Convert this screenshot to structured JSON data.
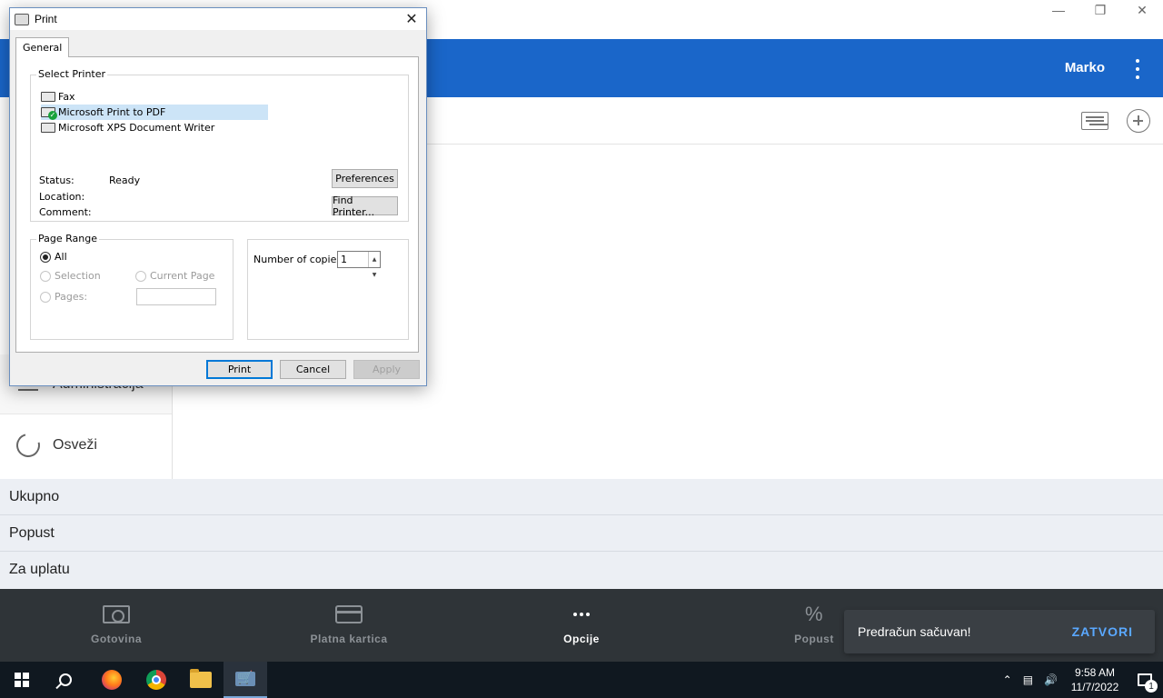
{
  "app": {
    "user_name": "Marko",
    "sidebar": {
      "admin_label": "Administracija",
      "refresh_label": "Osveži"
    },
    "totals": {
      "rows": [
        "Ukupno",
        "Popust",
        "Za uplatu"
      ]
    },
    "bottom_bar": {
      "cash_label": "Gotovina",
      "card_label": "Platna kartica",
      "options_label": "Opcije",
      "discount_label": "Popust"
    },
    "snackbar": {
      "message": "Predračun sačuvan!",
      "action": "ZATVORI"
    },
    "colors": {
      "header": "#1a66c9",
      "bottom_bar": "#2f3438",
      "snackbar_action": "#5aa8ff"
    }
  },
  "dialog": {
    "title": "Print",
    "close_glyph": "✕",
    "tab_general": "General",
    "select_printer": {
      "title": "Select Printer",
      "printers": [
        "Fax",
        "Microsoft Print to PDF",
        "Microsoft XPS Document Writer"
      ],
      "selected_index": 1,
      "status_label": "Status:",
      "status_value": "Ready",
      "location_label": "Location:",
      "comment_label": "Comment:",
      "preferences_button": "Preferences",
      "find_printer_button": "Find Printer..."
    },
    "page_range": {
      "title": "Page Range",
      "all": "All",
      "selection": "Selection",
      "current_page": "Current Page",
      "pages": "Pages:"
    },
    "copies": {
      "label": "Number of copies:",
      "value": "1"
    },
    "buttons": {
      "print": "Print",
      "cancel": "Cancel",
      "apply": "Apply"
    }
  },
  "taskbar": {
    "time": "9:58 AM",
    "date": "11/7/2022",
    "notification_count": "1"
  }
}
